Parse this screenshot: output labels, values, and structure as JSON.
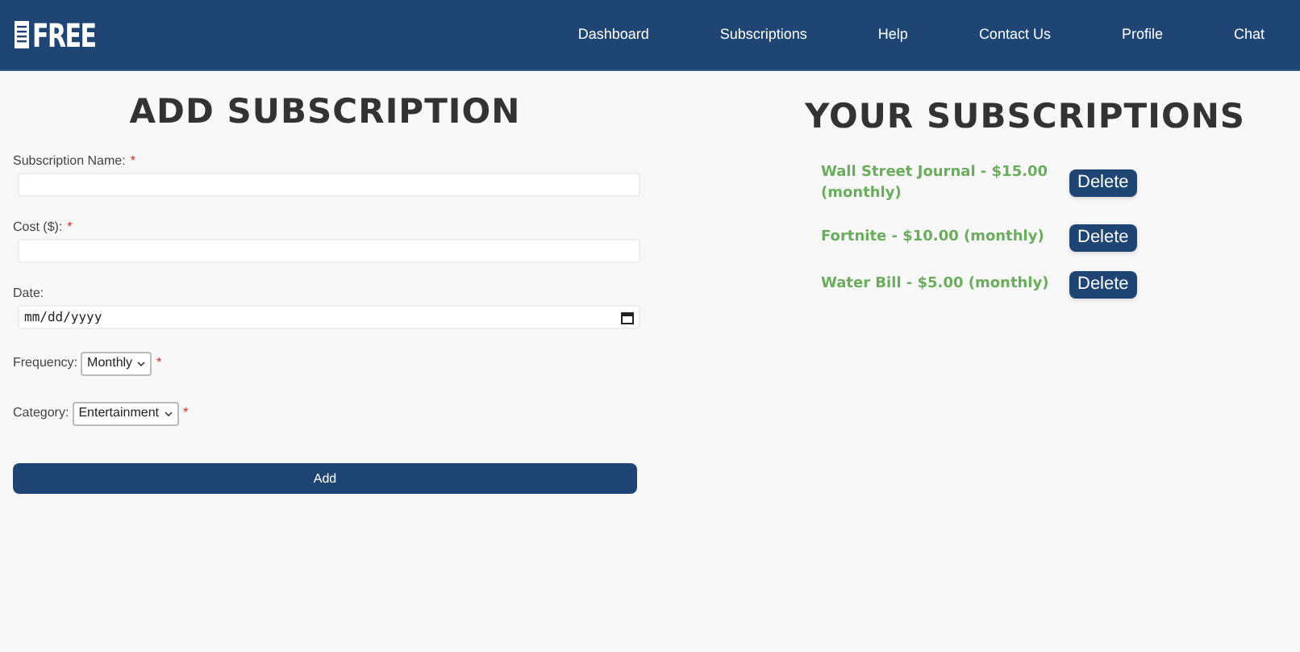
{
  "header": {
    "logo": "FREE",
    "nav": [
      {
        "label": "Dashboard"
      },
      {
        "label": "Subscriptions"
      },
      {
        "label": "Help"
      },
      {
        "label": "Contact Us"
      },
      {
        "label": "Profile"
      },
      {
        "label": "Chat"
      }
    ]
  },
  "form": {
    "title": "ADD SUBSCRIPTION",
    "fields": [
      {
        "kind": "text",
        "label": "Subscription Name:",
        "required_mark": "*"
      },
      {
        "kind": "text",
        "label": "Cost ($):",
        "required_mark": "*"
      },
      {
        "kind": "date",
        "label": "Date:",
        "placeholder": "mm/dd/yyyy"
      },
      {
        "kind": "select",
        "label": "Frequency:",
        "required_mark": "*",
        "value": "Monthly"
      },
      {
        "kind": "select",
        "label": "Category:",
        "required_mark": "*",
        "value": "Entertainment"
      }
    ],
    "submit": "Add"
  },
  "subscriptions": {
    "title": "YOUR SUBSCRIPTIONS",
    "items": [
      {
        "text": "Wall Street Journal - $15.00 (monthly)",
        "action": "Delete"
      },
      {
        "text": "Fortnite - $10.00 (monthly)",
        "action": "Delete"
      },
      {
        "text": "Water Bill - $5.00 (monthly)",
        "action": "Delete"
      }
    ]
  }
}
